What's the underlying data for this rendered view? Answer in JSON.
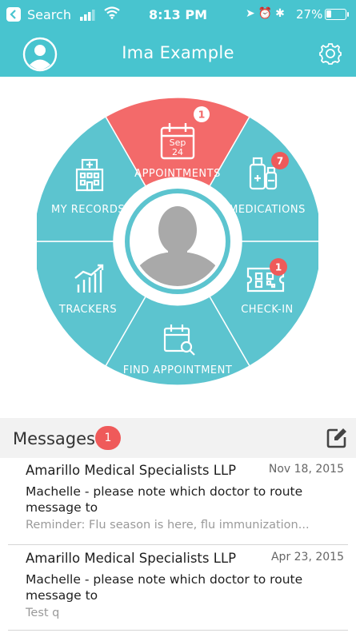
{
  "status_bar": {
    "carrier": "Search",
    "time": "8:13 PM",
    "battery": "27%",
    "battery_level": 0.27,
    "icons": [
      "back-arrow-icon",
      "signal-icon",
      "wifi-icon",
      "location-icon",
      "alarm-icon",
      "bluetooth-icon",
      "battery-icon"
    ]
  },
  "header": {
    "title": "Ima Example",
    "icons": [
      "user-avatar-icon",
      "gear-icon"
    ]
  },
  "wheel": {
    "segments": [
      {
        "id": "appointments",
        "label": "APPOINTMENTS",
        "icon": "calendar-icon",
        "calendar_month": "Sep",
        "calendar_day": "24",
        "badge": "1",
        "active": true
      },
      {
        "id": "medications",
        "label": "MEDICATIONS",
        "icon": "medications-icon",
        "badge": "7",
        "active": false
      },
      {
        "id": "check-in",
        "label": "CHECK-IN",
        "icon": "ticket-qr-icon",
        "badge": "1",
        "active": false
      },
      {
        "id": "find-appointment",
        "label": "FIND APPOINTMENT",
        "icon": "calendar-search-icon",
        "badge": null,
        "active": false
      },
      {
        "id": "trackers",
        "label": "TRACKERS",
        "icon": "chart-trend-icon",
        "badge": null,
        "active": false
      },
      {
        "id": "my-records",
        "label": "MY RECORDS",
        "icon": "hospital-icon",
        "badge": null,
        "active": false
      }
    ],
    "center": "profile-photo-placeholder-icon"
  },
  "messages": {
    "label": "Messages",
    "unread_count": "1",
    "compose_icon": "compose-icon",
    "items": [
      {
        "sender": "Amarillo Medical Specialists LLP",
        "date": "Nov 18, 2015",
        "subject": "Machelle - please note which doctor to route message to",
        "preview": "Reminder: Flu season is here, flu immunization..."
      },
      {
        "sender": "Amarillo Medical Specialists LLP",
        "date": "Apr 23, 2015",
        "subject": "Machelle - please note which doctor to route message to",
        "preview": "Test q"
      }
    ]
  },
  "colors": {
    "teal": "#48c4cf",
    "wheel_teal": "#5cc4cf",
    "active_red": "#f36a6a",
    "badge_red": "#ef5a5a",
    "header_band": "#f2f2f2"
  }
}
